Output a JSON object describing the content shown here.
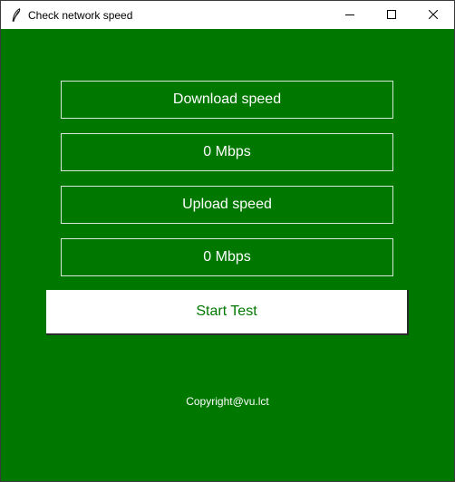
{
  "window": {
    "title": "Check network speed",
    "app_icon": "feather-icon",
    "controls": {
      "minimize_icon": "minimize-icon",
      "maximize_icon": "maximize-icon",
      "close_icon": "close-icon"
    }
  },
  "main": {
    "download_label": "Download speed",
    "download_value": "0 Mbps",
    "upload_label": "Upload speed",
    "upload_value": "0 Mbps",
    "start_button_label": "Start Test",
    "copyright": "Copyright@vu.lct"
  },
  "colors": {
    "background": "#007800",
    "button_background": "#ffffff",
    "button_text": "#007800",
    "text": "#ffffff"
  }
}
